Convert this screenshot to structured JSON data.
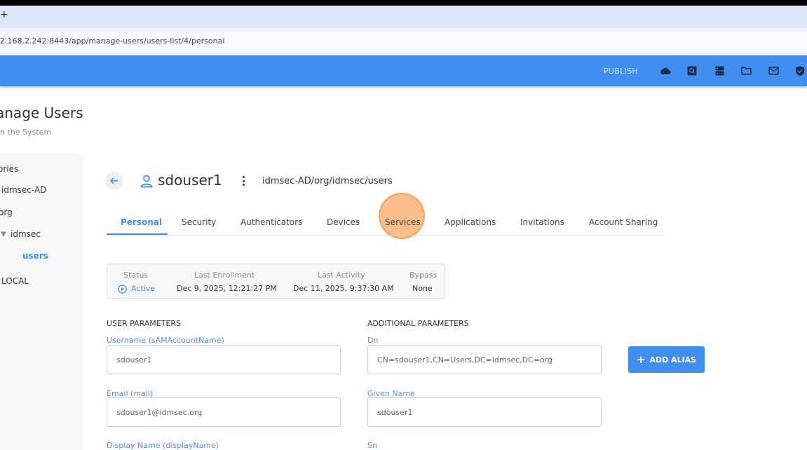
{
  "browser": {
    "new_tab_glyph": "+",
    "url": "2.168.2.242:8443/app/manage-users/users-list/4/personal"
  },
  "appbar": {
    "publish_label": "PUBLISH",
    "icons": [
      "cloud-icon",
      "search-box-icon",
      "server-icon",
      "folder-icon",
      "mail-icon",
      "shield-check-icon"
    ]
  },
  "page": {
    "title": "anage Users",
    "subtitle": "in the System"
  },
  "sidebar": {
    "items": [
      {
        "label": "ories"
      },
      {
        "label": "idmsec-AD"
      },
      {
        "label": "org"
      },
      {
        "label": "idmsec"
      },
      {
        "label": "users"
      },
      {
        "label": "LOCAL"
      }
    ]
  },
  "user": {
    "name": "sdouser1",
    "path": "idmsec-AD/org/idmsec/users"
  },
  "tabs": [
    {
      "label": "Personal"
    },
    {
      "label": "Security"
    },
    {
      "label": "Authenticators"
    },
    {
      "label": "Devices"
    },
    {
      "label": "Services"
    },
    {
      "label": "Applications"
    },
    {
      "label": "Invitations"
    },
    {
      "label": "Account Sharing"
    }
  ],
  "status": {
    "status_header": "Status",
    "status_value": "Active",
    "enroll_header": "Last Enrollment",
    "enroll_value": "Dec 9, 2025, 12:21:27 PM",
    "activity_header": "Last Activity",
    "activity_value": "Dec 11, 2025, 9:37:30 AM",
    "bypass_header": "Bypass",
    "bypass_value": "None"
  },
  "user_params": {
    "heading": "USER PARAMETERS",
    "username_label": "Username (sAMAccountName)",
    "username_value": "sdouser1",
    "email_label": "Email (mail)",
    "email_value": "sdouser1@idmsec.org",
    "display_label": "Display Name (displayName)"
  },
  "additional_params": {
    "heading": "ADDITIONAL PARAMETERS",
    "dn_label": "Dn",
    "dn_value": "CN=sdouser1,CN=Users,DC=idmsec,DC=org",
    "given_label": "Given Name",
    "given_value": "sdouser1",
    "sn_label": "Sn"
  },
  "alias_button": {
    "plus": "+",
    "label": "ADD ALIAS"
  },
  "colors": {
    "accent": "#3f8ef0",
    "field_label": "#5b8fd8",
    "ripple": "#f6aa64"
  }
}
